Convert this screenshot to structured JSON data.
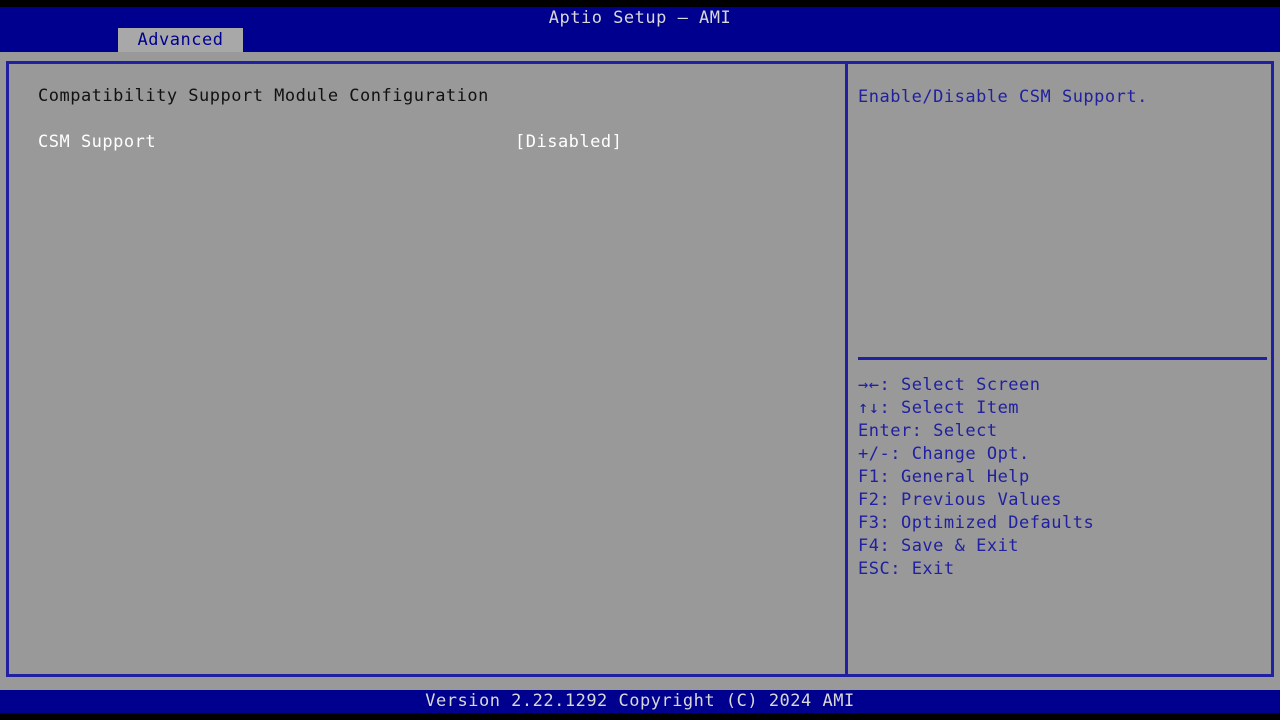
{
  "header": {
    "title": "Aptio Setup – AMI",
    "tabs": [
      {
        "label": "Advanced",
        "active": true
      }
    ]
  },
  "main": {
    "section_heading": "Compatibility Support Module Configuration",
    "options": [
      {
        "label": "CSM Support",
        "value": "[Disabled]"
      }
    ]
  },
  "help": {
    "text": "Enable/Disable CSM Support."
  },
  "legend": {
    "items": [
      {
        "keys": "→←:",
        "action": "Select Screen"
      },
      {
        "keys": "↑↓:",
        "action": "Select Item"
      },
      {
        "keys": "Enter:",
        "action": "Select"
      },
      {
        "keys": "+/-:",
        "action": "Change Opt."
      },
      {
        "keys": "F1:",
        "action": "General Help"
      },
      {
        "keys": "F2:",
        "action": "Previous Values"
      },
      {
        "keys": "F3:",
        "action": "Optimized Defaults"
      },
      {
        "keys": "F4:",
        "action": "Save & Exit"
      },
      {
        "keys": "ESC:",
        "action": "Exit"
      }
    ]
  },
  "footer": {
    "version_text": "Version 2.22.1292 Copyright (C) 2024 AMI"
  },
  "colors": {
    "header_blue": "#00008f",
    "panel_gray": "#999999",
    "border_blue": "#2020a0",
    "tab_gray": "#a8a8a8",
    "text_white": "#ffffff",
    "text_dark": "#111111"
  }
}
